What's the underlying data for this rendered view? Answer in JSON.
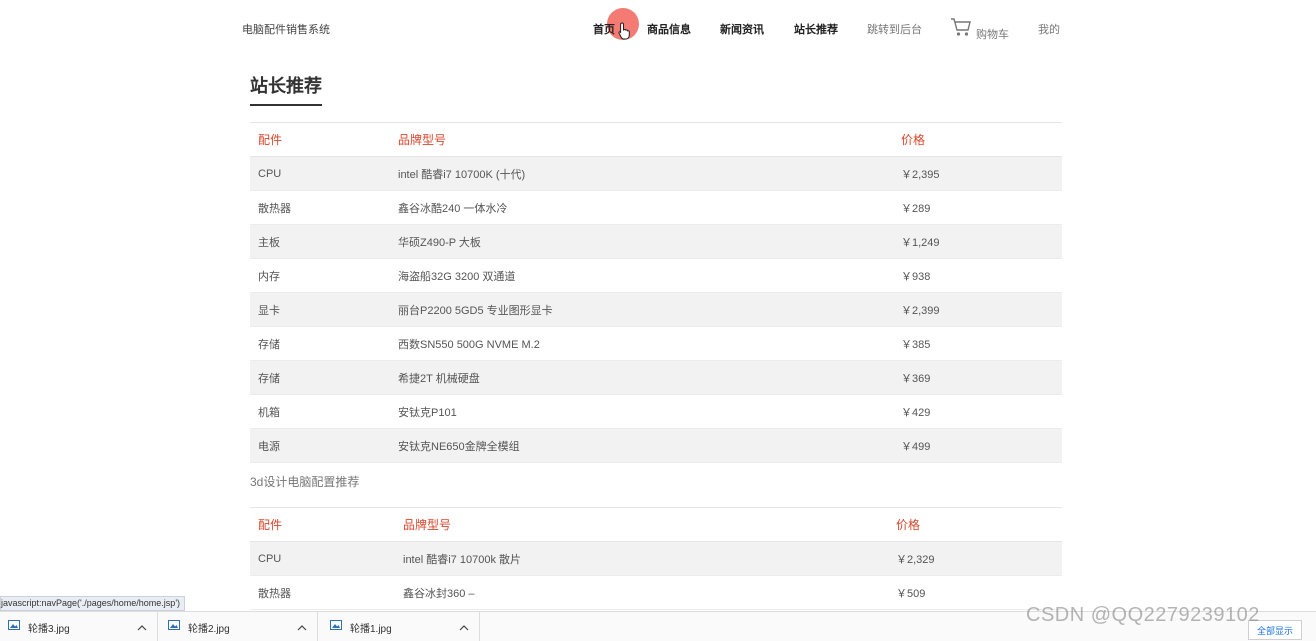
{
  "header": {
    "brand": "电脑配件销售系统",
    "nav": [
      "首页",
      "商品信息",
      "新闻资讯",
      "站长推荐",
      "跳转到后台"
    ],
    "cart_label": "购物车",
    "mine_label": "我的"
  },
  "section_title": "站长推荐",
  "table1": {
    "headers": [
      "配件",
      "品牌型号",
      "价格"
    ],
    "rows": [
      {
        "part": "CPU",
        "model": "intel 酷睿i7 10700K (十代)",
        "price": "￥2,395"
      },
      {
        "part": "散热器",
        "model": "鑫谷冰酷240 一体水冷",
        "price": "￥289"
      },
      {
        "part": "主板",
        "model": "华硕Z490-P 大板",
        "price": "￥1,249"
      },
      {
        "part": "内存",
        "model": "海盗船32G 3200 双通道",
        "price": "￥938"
      },
      {
        "part": "显卡",
        "model": "丽台P2200 5GD5 专业图形显卡",
        "price": "￥2,399"
      },
      {
        "part": "存储",
        "model": "西数SN550 500G NVME M.2",
        "price": "￥385"
      },
      {
        "part": "存储",
        "model": "希捷2T 机械硬盘",
        "price": "￥369"
      },
      {
        "part": "机箱",
        "model": "安钛克P101",
        "price": "￥429"
      },
      {
        "part": "电源",
        "model": "安钛克NE650金牌全模组",
        "price": "￥499"
      }
    ]
  },
  "subtitle": "3d设计电脑配置推荐",
  "table2": {
    "headers": [
      "配件",
      "品牌型号",
      "价格"
    ],
    "rows": [
      {
        "part": "CPU",
        "model": "intel 酷睿i7 10700k 散片",
        "price": "￥2,329"
      },
      {
        "part": "散热器",
        "model": "鑫谷冰封360 –",
        "price": "￥509"
      }
    ]
  },
  "status_url": "javascript:navPage('./pages/home/home.jsp')",
  "downloads": [
    "轮播3.jpg",
    "轮播2.jpg",
    "轮播1.jpg"
  ],
  "show_all_label": "全部显示",
  "watermark": "CSDN @QQ2279239102",
  "colors": {
    "accent": "#d9472b",
    "row_alt": "#f2f2f2",
    "click_indicator": "#f05a50"
  }
}
